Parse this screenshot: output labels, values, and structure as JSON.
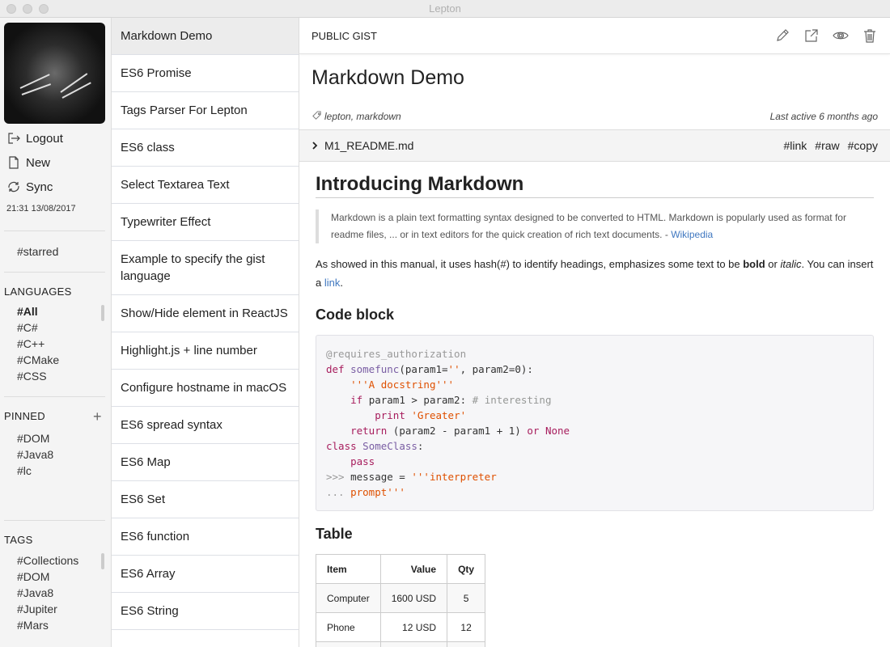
{
  "window": {
    "title": "Lepton"
  },
  "nav": {
    "actions": [
      {
        "label": "Logout",
        "icon": "logout-icon"
      },
      {
        "label": "New",
        "icon": "new-file-icon"
      },
      {
        "label": "Sync",
        "icon": "sync-icon"
      }
    ],
    "sync_time": "21:31 13/08/2017",
    "starred": "#starred",
    "languages": {
      "title": "LANGUAGES",
      "items": [
        "#All",
        "#C#",
        "#C++",
        "#CMake",
        "#CSS"
      ],
      "active": "#All"
    },
    "pinned": {
      "title": "PINNED",
      "add": "+",
      "items": [
        "#DOM",
        "#Java8",
        "#lc"
      ]
    },
    "tags": {
      "title": "TAGS",
      "items": [
        "#Collections",
        "#DOM",
        "#Java8",
        "#Jupiter",
        "#Mars"
      ]
    }
  },
  "gists": [
    "Markdown Demo",
    "ES6 Promise",
    "Tags Parser For Lepton",
    "ES6 class",
    "Select Textarea Text",
    "Typewriter Effect",
    "Example to specify the gist language",
    "Show/Hide element in ReactJS",
    "Highlight.js + line number",
    "Configure hostname in macOS",
    "ES6 spread syntax",
    "ES6 Map",
    "ES6 Set",
    "ES6 function",
    "ES6 Array",
    "ES6 String"
  ],
  "detail": {
    "visibility": "PUBLIC GIST",
    "title": "Markdown Demo",
    "tags": "lepton, markdown",
    "last_active": "Last active 6 months ago",
    "file": {
      "name": "M1_README.md",
      "links": [
        "#link",
        "#raw",
        "#copy"
      ]
    },
    "md": {
      "h1": "Introducing Markdown",
      "quote": "Markdown is a plain text formatting syntax designed to be converted to HTML. Markdown is popularly used as format for readme files, ... or in text editors for the quick creation of rich text documents. - ",
      "quote_link": "Wikipedia",
      "p1_a": "As showed in this manual, it uses hash(#) to identify headings, emphasizes some text to be ",
      "p1_bold": "bold",
      "p1_b": " or ",
      "p1_italic": "italic",
      "p1_c": ". You can insert a ",
      "p1_link": "link",
      "p1_d": ".",
      "h_code": "Code block",
      "h_table": "Table",
      "table": {
        "headers": [
          "Item",
          "Value",
          "Qty"
        ],
        "rows": [
          [
            "Computer",
            "1600 USD",
            "5"
          ],
          [
            "Phone",
            "12 USD",
            "12"
          ],
          [
            "",
            "",
            ""
          ]
        ]
      }
    }
  }
}
